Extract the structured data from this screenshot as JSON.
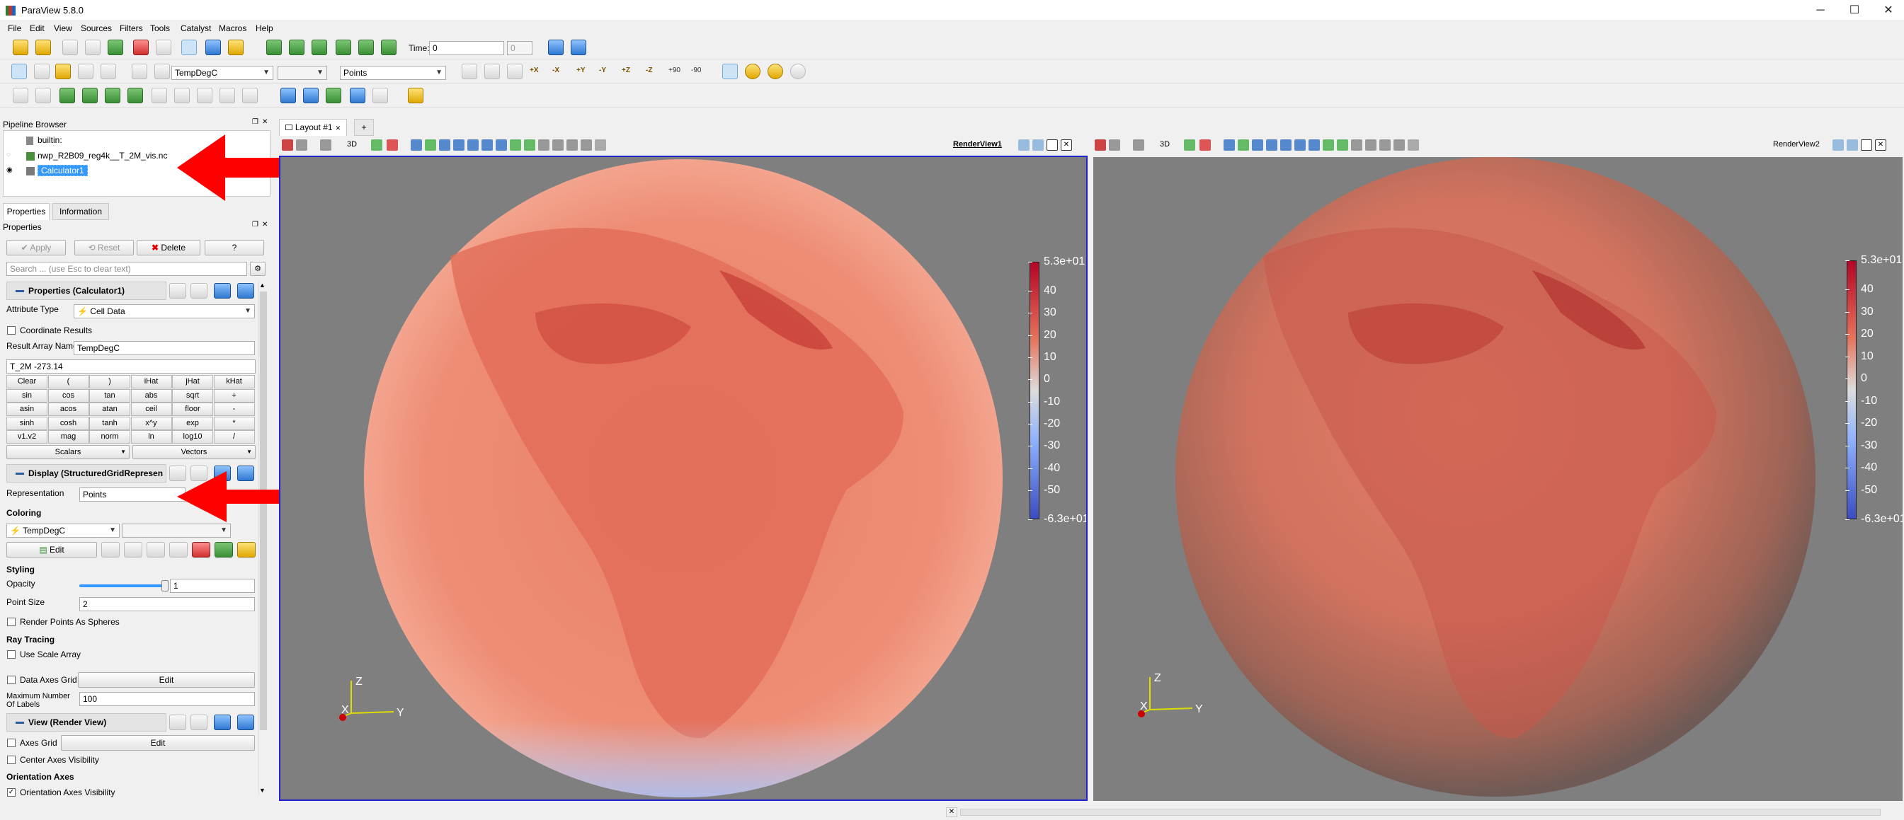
{
  "window": {
    "title": "ParaView 5.8.0",
    "minimize": "─",
    "maximize": "☐",
    "close": "✕"
  },
  "menu": [
    "File",
    "Edit",
    "View",
    "Sources",
    "Filters",
    "Tools",
    "Catalyst",
    "Macros",
    "Help"
  ],
  "toolbar": {
    "time_label": "Time:",
    "time_value": "0",
    "time_index": "0",
    "color_array": "TempDegC",
    "representation": "Points",
    "axis_buttons": [
      "+X",
      "-X",
      "+Y",
      "-Y",
      "+Z",
      "-Z"
    ],
    "rotate_buttons": [
      "+90",
      "-90"
    ]
  },
  "pipeline_browser": {
    "title": "Pipeline Browser",
    "items": [
      "builtin:",
      "nwp_R2B09_reg4k__T_2M_vis.nc",
      "Calculator1"
    ]
  },
  "tabs": {
    "properties": "Properties",
    "information": "Information"
  },
  "properties": {
    "title": "Properties",
    "apply": "Apply",
    "reset": "Reset",
    "delete": "Delete",
    "help": "?",
    "search_placeholder": "Search ... (use Esc to clear text)",
    "section_calculator": "Properties (Calculator1)",
    "attribute_type_label": "Attribute Type",
    "attribute_type_value": "Cell Data",
    "coordinate_results": "Coordinate Results",
    "result_array_label": "Result Array Name",
    "result_array_value": "TempDegC",
    "expression": "T_2M -273.14",
    "calc_buttons": [
      [
        "Clear",
        "(",
        ")",
        "iHat",
        "jHat",
        "kHat"
      ],
      [
        "sin",
        "cos",
        "tan",
        "abs",
        "sqrt",
        "+"
      ],
      [
        "asin",
        "acos",
        "atan",
        "ceil",
        "floor",
        "-"
      ],
      [
        "sinh",
        "cosh",
        "tanh",
        "x^y",
        "exp",
        "*"
      ],
      [
        "v1.v2",
        "mag",
        "norm",
        "ln",
        "log10",
        "/"
      ]
    ],
    "scalars": "Scalars",
    "vectors": "Vectors",
    "section_display": "Display (StructuredGridRepresen",
    "representation_label": "Representation",
    "representation_value": "Points",
    "coloring_header": "Coloring",
    "coloring_value": "TempDegC",
    "edit": "Edit",
    "styling_header": "Styling",
    "opacity_label": "Opacity",
    "opacity_value": "1",
    "opacity_fraction": 1.0,
    "point_size_label": "Point Size",
    "point_size_value": "2",
    "render_points_spheres": "Render Points As Spheres",
    "ray_tracing_header": "Ray Tracing",
    "use_scale_array": "Use Scale Array",
    "data_axes_grid": "Data Axes Grid",
    "data_axes_edit": "Edit",
    "max_labels_label": "Maximum Number Of Labels",
    "max_labels_value": "100",
    "section_view": "View (Render View)",
    "axes_grid": "Axes Grid",
    "axes_grid_edit": "Edit",
    "center_axes_visibility": "Center Axes Visibility",
    "orientation_axes_header": "Orientation Axes",
    "orientation_axes_visibility": "Orientation Axes Visibility"
  },
  "layout": {
    "tab": "Layout #1",
    "add": "+"
  },
  "views": {
    "left": {
      "name": "RenderView1",
      "label_3d": "3D"
    },
    "right": {
      "name": "RenderView2",
      "label_3d": "3D"
    }
  },
  "colorbar": {
    "ticks": [
      "5.3e+01",
      "40",
      "30",
      "20",
      "10",
      "0",
      "-10",
      "-20",
      "-30",
      "-40",
      "-50",
      "-6.3e+01"
    ]
  },
  "axes_labels": {
    "x": "X",
    "y": "Y",
    "z": "Z"
  },
  "colors": {
    "accent_red": "#ff0000",
    "selection_blue": "#3399ff",
    "view_border": "#2222cc"
  }
}
